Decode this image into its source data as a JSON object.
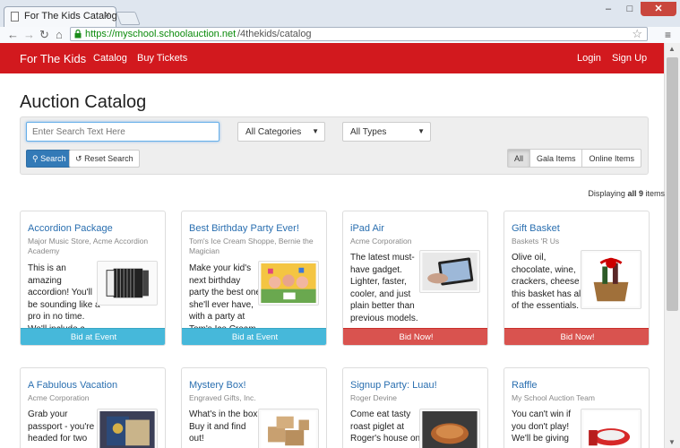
{
  "browser": {
    "tab_title": "For The Kids Catalog",
    "tab_close": "×",
    "url_secure": "https://myschool.schoolauction.net",
    "url_path": "/4thekids/catalog",
    "win_min": "–",
    "win_max": "□",
    "win_close": "✕"
  },
  "nav": {
    "brand": "For The Kids",
    "links": [
      "Catalog",
      "Buy Tickets"
    ],
    "login": "Login",
    "signup": "Sign Up",
    "color": "#d2191e"
  },
  "page": {
    "title": "Auction Catalog"
  },
  "filters": {
    "search_placeholder": "Enter Search Text Here",
    "category": "All Categories",
    "type": "All Types",
    "search_btn": "Search",
    "reset_btn": "Reset Search",
    "toggle": [
      "All",
      "Gala Items",
      "Online Items"
    ],
    "active_toggle": "All"
  },
  "results": {
    "prefix": "Displaying",
    "count_text": "all 9",
    "suffix": "items"
  },
  "items": [
    {
      "title": "Accordion Package",
      "donor": "Major Music Store, Acme Accordion Academy",
      "desc": "This is an amazing accordion! You'll be sounding like a pro in no time. We'll include a strap, and lessons",
      "button": "Bid at Event",
      "icon": "accordion-image"
    },
    {
      "title": "Best Birthday Party Ever!",
      "donor": "Tom's Ice Cream Shoppe, Bernie the Magician",
      "desc": "Make your kid's next birthday party the best one she'll ever have, with a party at Tom's Ice Cream Shoppe in",
      "button": "Bid at Event",
      "icon": "party-image"
    },
    {
      "title": "iPad Air",
      "donor": "Acme Corporation",
      "desc": "The latest must-have gadget. Lighter, faster, cooler, and just plain better than previous models.",
      "button": "Bid Now!",
      "icon": "tablet-image"
    },
    {
      "title": "Gift Basket",
      "donor": "Baskets 'R Us",
      "desc": "Olive oil, chocolate, wine, crackers, cheese - this basket has all of the essentials.",
      "button": "Bid Now!",
      "icon": "gift-basket-image"
    },
    {
      "title": "A Fabulous Vacation",
      "donor": "Acme Corporation",
      "desc": "Grab your passport - you're headed for two",
      "button": "",
      "icon": "passport-image"
    },
    {
      "title": "Mystery Box!",
      "donor": "Engraved Gifts, Inc.",
      "desc": "What's in the box? Buy it and find out!",
      "button": "",
      "icon": "boxes-image"
    },
    {
      "title": "Signup Party: Luau!",
      "donor": "Roger Devine",
      "desc": "Come eat tasty roast piglet at Roger's house on",
      "button": "",
      "icon": "luau-image"
    },
    {
      "title": "Raffle",
      "donor": "My School Auction Team",
      "desc": "You can't win if you don't play! We'll be giving",
      "button": "",
      "icon": "ribbon-image"
    }
  ]
}
